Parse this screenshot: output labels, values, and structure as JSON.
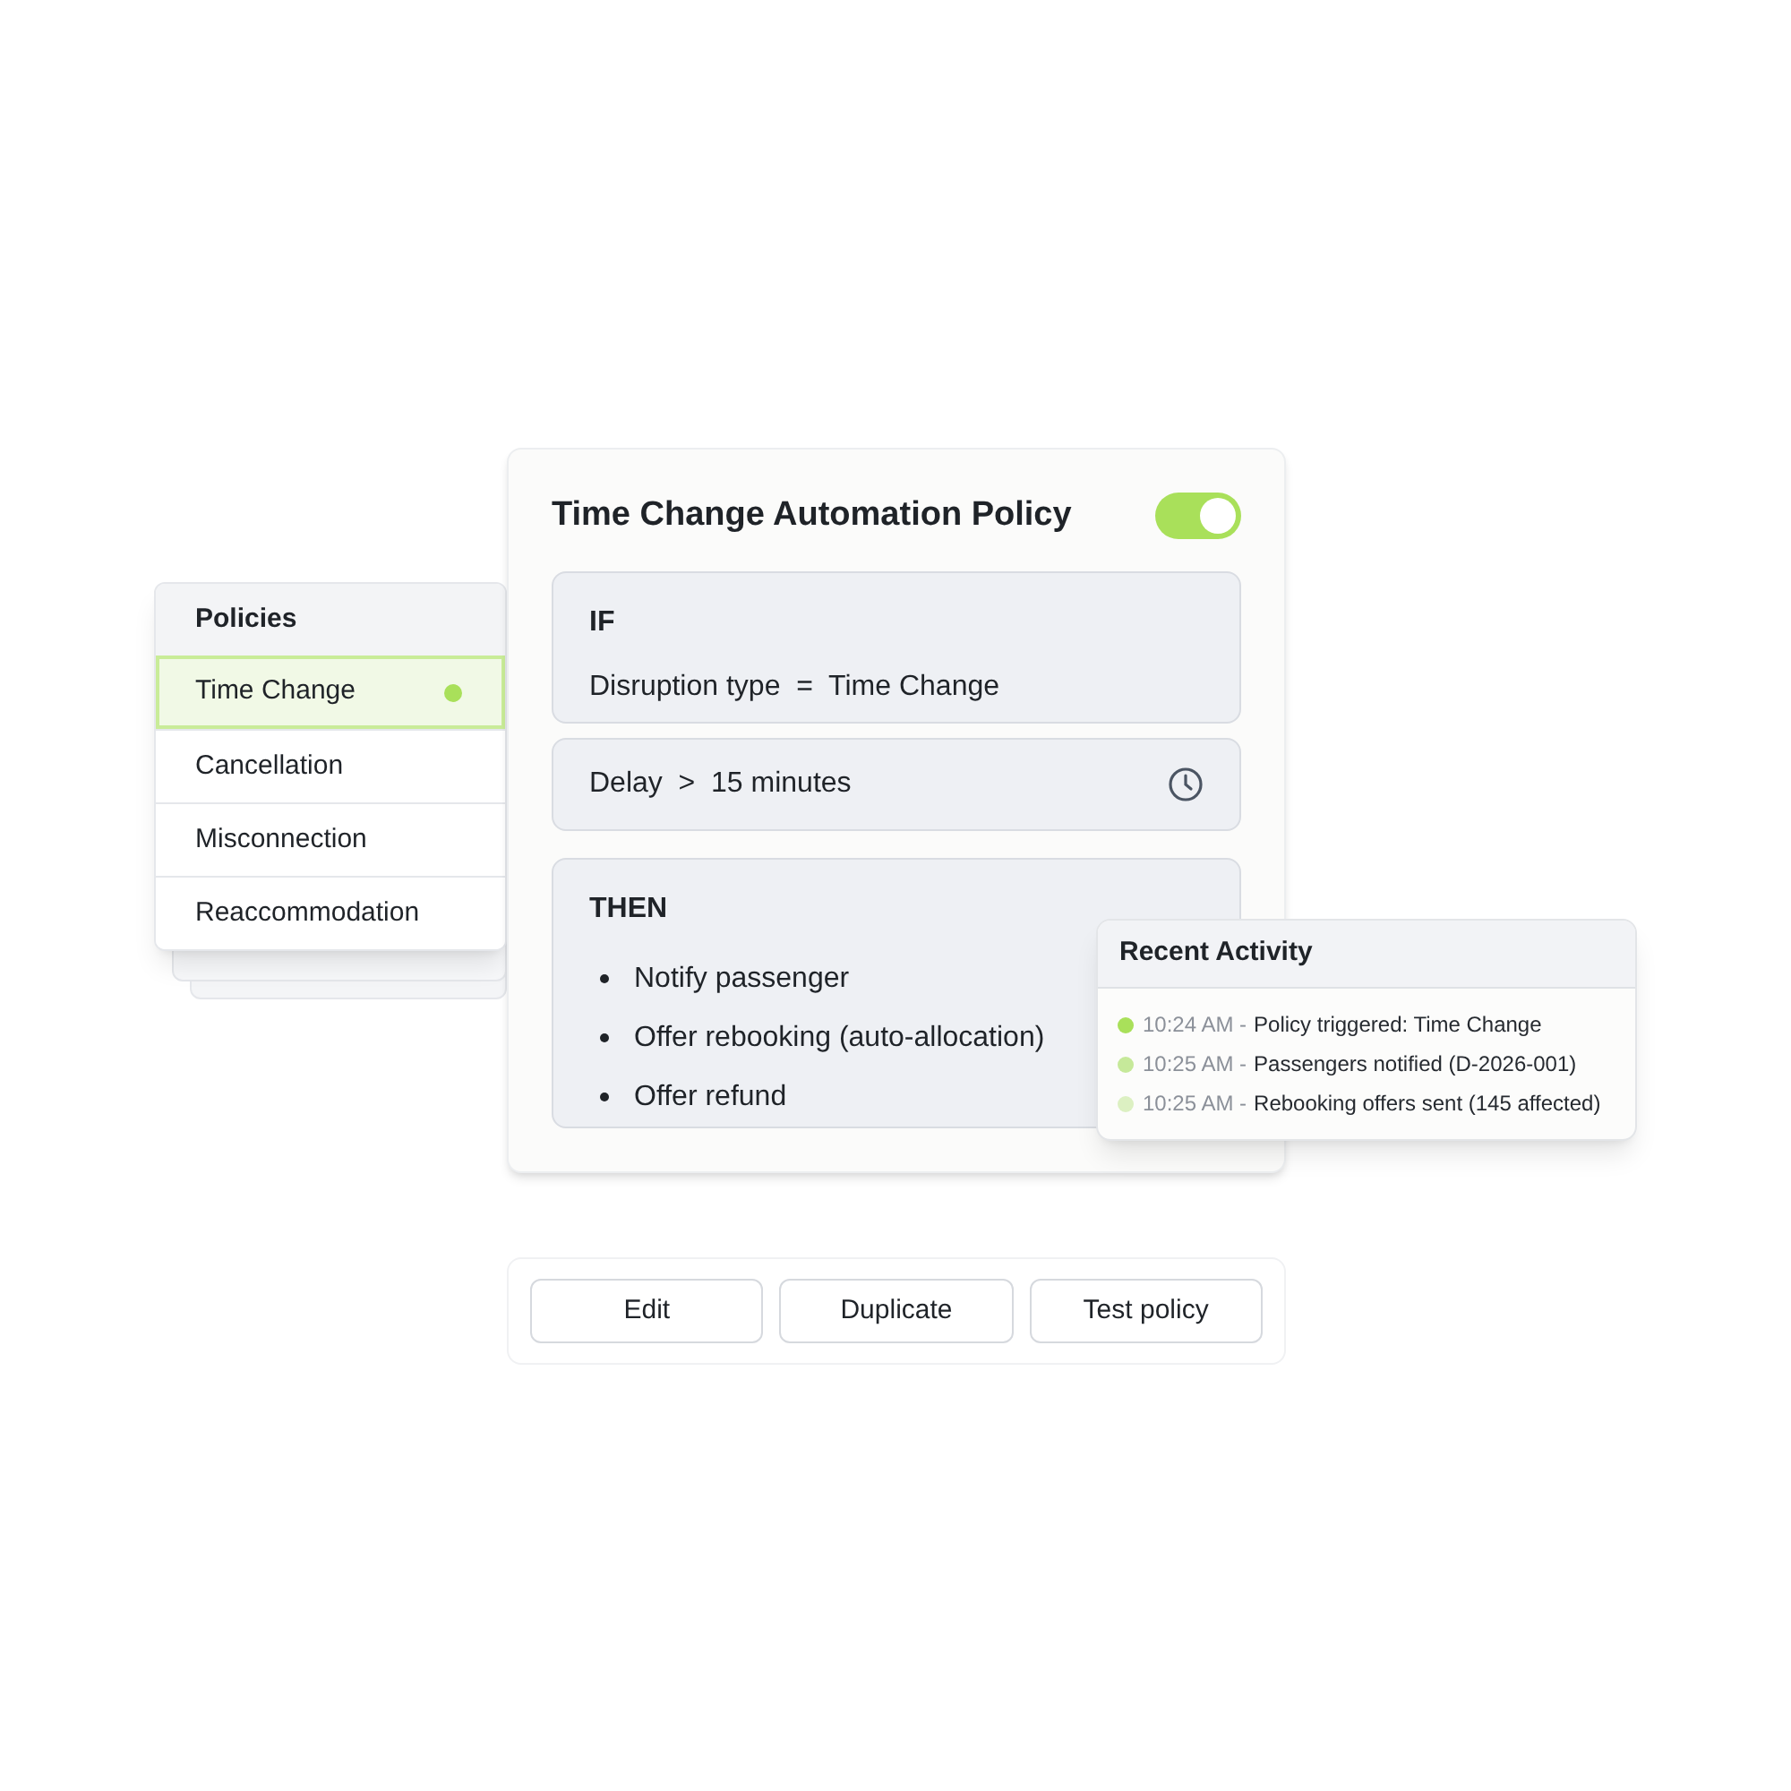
{
  "policies": {
    "title": "Policies",
    "items": [
      {
        "label": "Time Change",
        "selected": true
      },
      {
        "label": "Cancellation",
        "selected": false
      },
      {
        "label": "Misconnection",
        "selected": false
      },
      {
        "label": "Reaccommodation",
        "selected": false
      }
    ]
  },
  "policy": {
    "title": "Time Change Automation Policy",
    "enabled": true,
    "if": {
      "heading": "IF",
      "condition": "Disruption type  =  Time Change"
    },
    "delay": {
      "condition": "Delay  >  15 minutes"
    },
    "then": {
      "heading": "THEN",
      "actions": [
        "Notify passenger",
        "Offer rebooking (auto-allocation)",
        "Offer refund"
      ]
    }
  },
  "activity": {
    "title": "Recent Activity",
    "entries": [
      {
        "time": "10:24 AM -",
        "text": "Policy triggered: Time Change",
        "color": "#a9e05a"
      },
      {
        "time": "10:25 AM -",
        "text": "Passengers notified (D-2026-001)",
        "color": "#c6e99a"
      },
      {
        "time": "10:25 AM -",
        "text": "Rebooking offers sent (145 affected)",
        "color": "#dcf0c2"
      }
    ]
  },
  "buttons": [
    "Edit",
    "Duplicate",
    "Test policy"
  ]
}
